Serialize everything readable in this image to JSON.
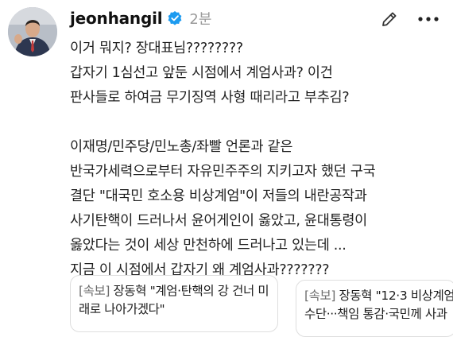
{
  "post": {
    "username": "jeonhangil",
    "timestamp": "2분",
    "paragraphs": [
      [
        "이거 뭐지? 장대표님????????",
        "갑자기 1심선고 앞둔 시점에서 계엄사과? 이건",
        "판사들로 하여금 무기징역 사형 때리라고 부추김?"
      ],
      [
        "이재명/민주당/민노총/좌빨 언론과 같은",
        "반국가세력으로부터 자유민주주의 지키고자 했던 구국",
        "결단 \"대국민 호소용 비상계엄\"이 저들의 내란공작과",
        "사기탄핵이 드러나서 윤어게인이 옳았고, 윤대통령이",
        "옳았다는 것이 세상 만천하에 드러나고 있는데 ...",
        "지금 이 시점에서 갑자기 왜 계엄사과???????"
      ]
    ]
  },
  "link_cards": [
    {
      "tag": "[속보]",
      "lines": [
        " 장동혁 \"계엄·탄핵의 강 건너 미",
        "래로 나아가겠다\""
      ]
    },
    {
      "tag": "[속보]",
      "lines": [
        " 장동혁 \"12·3 비상계엄",
        "수단···책임 통감·국민께 사과"
      ]
    }
  ],
  "icons": {
    "verified": "verified-badge-icon",
    "edit": "pencil-icon",
    "more": "more-horizontal-icon"
  },
  "colors": {
    "verified": "#1d9bf0",
    "text": "#1f1f1f",
    "muted": "#9a9a9a"
  }
}
